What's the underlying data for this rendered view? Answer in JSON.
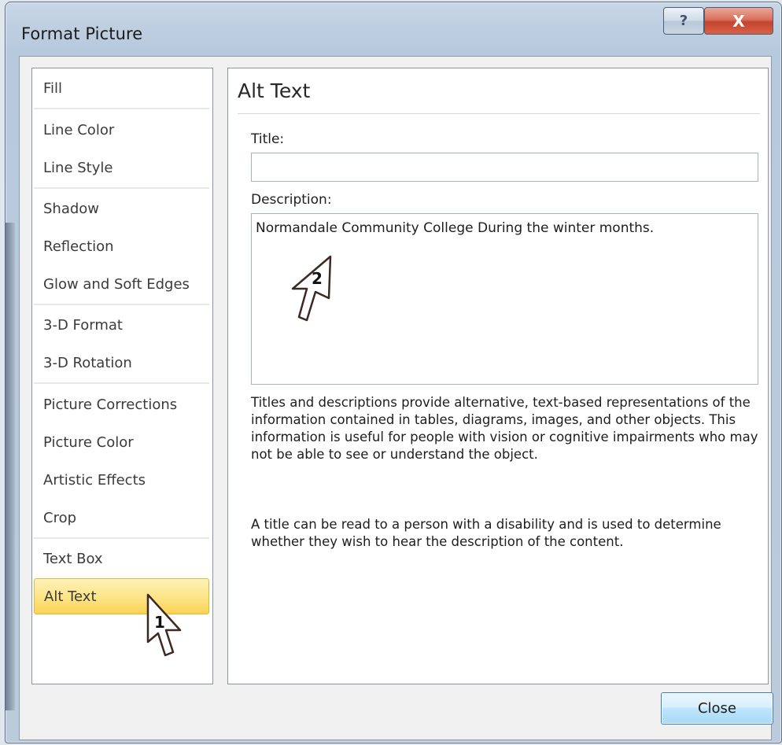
{
  "window": {
    "title": "Format Picture",
    "help_glyph": "?",
    "close_glyph": "X"
  },
  "nav": {
    "items": [
      {
        "label": "Fill",
        "selected": false
      },
      {
        "label": "Line Color",
        "selected": false
      },
      {
        "label": "Line Style",
        "selected": false
      },
      {
        "label": "Shadow",
        "selected": false
      },
      {
        "label": "Reflection",
        "selected": false
      },
      {
        "label": "Glow and Soft Edges",
        "selected": false
      },
      {
        "label": "3-D Format",
        "selected": false
      },
      {
        "label": "3-D Rotation",
        "selected": false
      },
      {
        "label": "Picture Corrections",
        "selected": false
      },
      {
        "label": "Picture Color",
        "selected": false
      },
      {
        "label": "Artistic Effects",
        "selected": false
      },
      {
        "label": "Crop",
        "selected": false
      },
      {
        "label": "Text Box",
        "selected": false
      },
      {
        "label": "Alt Text",
        "selected": true
      }
    ]
  },
  "panel": {
    "heading": "Alt Text",
    "title_label": "Title:",
    "title_value": "",
    "description_label": "Description:",
    "description_value": "Normandale Community College During the winter months.",
    "help_paragraph_1": "Titles and descriptions provide alternative, text-based representations of the information contained in tables, diagrams, images, and other objects. This information is useful for people with vision or cognitive impairments who may not be able to see or understand the object.",
    "help_paragraph_2": "A title can be read to a person with a disability and is used to determine whether they wish to hear the description of the content."
  },
  "footer": {
    "close_label": "Close"
  },
  "callouts": {
    "step1": "1",
    "step2": "2"
  },
  "colors": {
    "selected_bg": "#fad355",
    "button_accent": "#3c7fb1",
    "close_red": "#c4432c"
  }
}
